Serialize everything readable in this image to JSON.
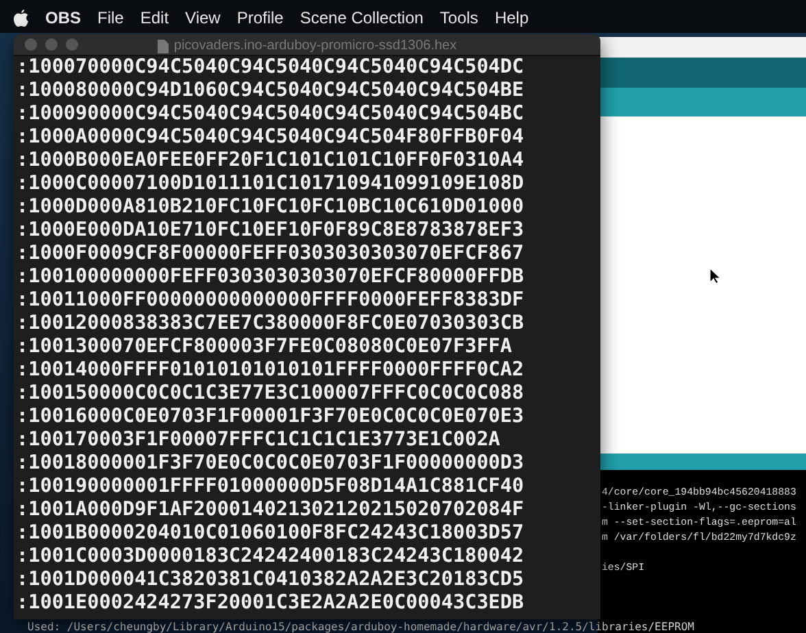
{
  "menu_bar": {
    "app_name": "OBS",
    "items": [
      "File",
      "Edit",
      "View",
      "Profile",
      "Scene Collection",
      "Tools",
      "Help"
    ]
  },
  "hex_window": {
    "title": "picovaders.ino-arduboy-promicro-ssd1306.hex",
    "lines": [
      ":100070000C94C5040C94C5040C94C5040C94C504DC",
      ":100080000C94D1060C94C5040C94C5040C94C504BE",
      ":100090000C94C5040C94C5040C94C5040C94C504BC",
      ":1000A0000C94C5040C94C5040C94C504F80FFB0F04",
      ":1000B000EA0FEE0FF20F1C101C101C10FF0F0310A4",
      ":1000C00007100D1011101C101710941099109E108D",
      ":1000D000A810B210FC10FC10FC10BC10C610D01000",
      ":1000E000DA10E710FC10EF10F0F89C8E8783878EF3",
      ":1000F0009CF8F00000FEFF0303030303070EFCF867",
      ":100100000000FEFF0303030303070EFCF80000FFDB",
      ":10011000FF00000000000000FFFF0000FEFF8383DF",
      ":10012000838383C7EE7C380000F8FC0E07030303CB",
      ":1001300070EFCF800003F7FE0C08080C0E07F3FFA",
      ":10014000FFFF01010101010101FFFF0000FFFF0CA2",
      ":100150000C0C0C1C3E77E3C100007FFFC0C0C0C088",
      ":10016000C0E0703F1F00001F3F70E0C0C0C0E070E3",
      ":100170003F1F00007FFFC1C1C1C1E3773E1C002A",
      ":10018000001F3F70E0C0C0C0E0703F1F00000000D3",
      ":100190000001FFFF01000000D5F08D14A1C881CF40",
      ":1001A000D9F1AF200014021302120215020702084F",
      ":1001B0000204010C01060100F8FC24243C18003D57",
      ":1001C0003D0000183C24242400183C24243C180042",
      ":1001D000041C3820381C0410382A2A2E3C20183CD5",
      ":1001E0002424273F20001C3E2A2A2E0C00043C3EDB"
    ]
  },
  "console": {
    "lines": [
      "4/core/core_194bb94bc45620418883",
      "-linker-plugin -Wl,--gc-sections",
      "m --set-section-flags=.eeprom=al",
      "m /var/folders/fl/bd22my7d7kdc9z",
      "ies/SPI"
    ],
    "footer": "Used: /Users/cheungby/Library/Arduino15/packages/arduboy-homemade/hardware/avr/1.2.5/libraries/EEPROM"
  }
}
